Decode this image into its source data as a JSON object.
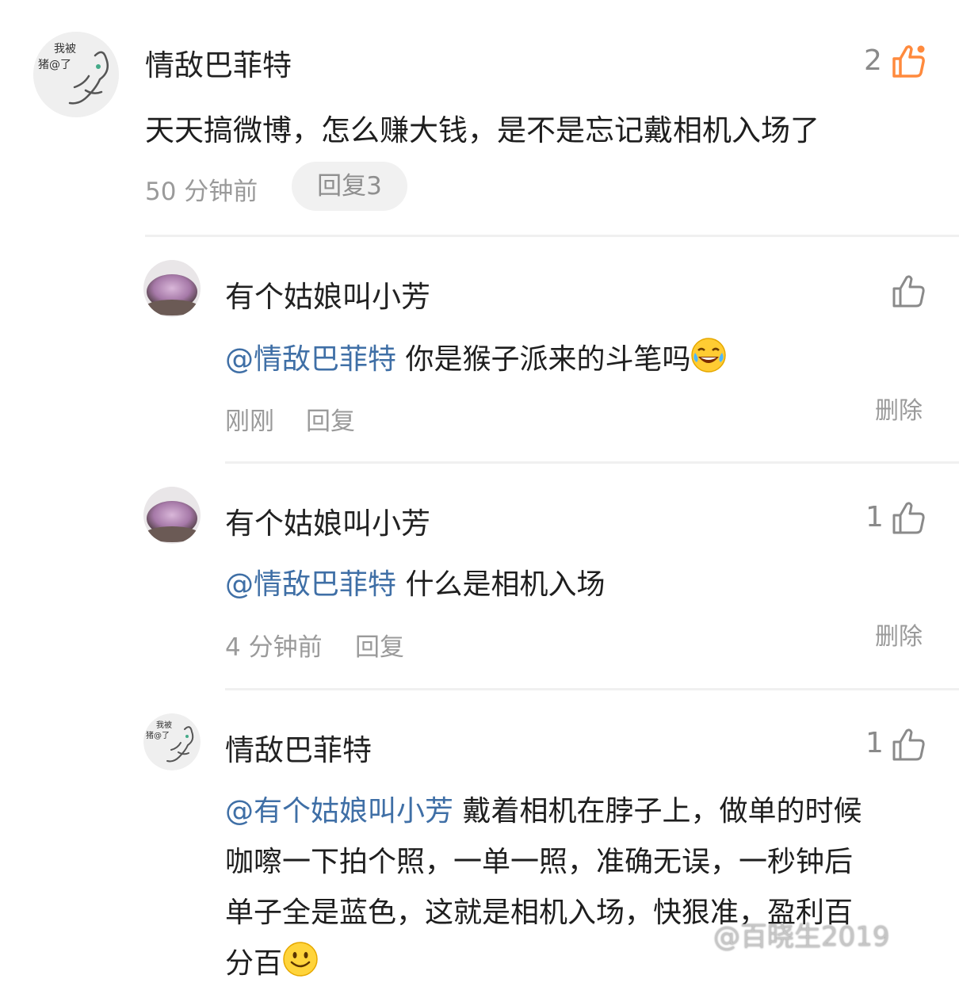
{
  "colors": {
    "mention": "#3f6fa6",
    "like_active": "#ff8a3d",
    "meta": "#9a9a9a"
  },
  "comment": {
    "author": "情敌巴菲特",
    "avatar_text_line1": "我被",
    "avatar_text_line2": "猪@了",
    "like_count": "2",
    "like_icon": "thumbs-up-icon",
    "text": "天天搞微博，怎么赚大钱，是不是忘记戴相机入场了",
    "time": "50 分钟前",
    "reply_button": "回复3"
  },
  "replies": [
    {
      "author": "有个姑娘叫小芳",
      "like_count": "",
      "mention": "@情敌巴菲特",
      "text": " 你是猴子派来的斗笔吗",
      "emoji": "laughing-tears-emoji-icon",
      "time": "刚刚",
      "reply": "回复",
      "delete": "删除"
    },
    {
      "author": "有个姑娘叫小芳",
      "like_count": "1",
      "mention": "@情敌巴菲特",
      "text": " 什么是相机入场",
      "time": "4 分钟前",
      "reply": "回复",
      "delete": "删除"
    },
    {
      "author": "情敌巴菲特",
      "like_count": "1",
      "mention": "@有个姑娘叫小芳",
      "text_line1": " 戴着相机在脖子上，做单的时候",
      "text_line2": "咖嚓一下拍个照，一单一照，准确无误，一秒钟后",
      "text_line3": "单子全是蓝色，这就是相机入场，快狠准，盈利百",
      "text_line4": "分百",
      "emoji": "smile-emoji-icon"
    }
  ],
  "watermark": "@百晓生2019"
}
